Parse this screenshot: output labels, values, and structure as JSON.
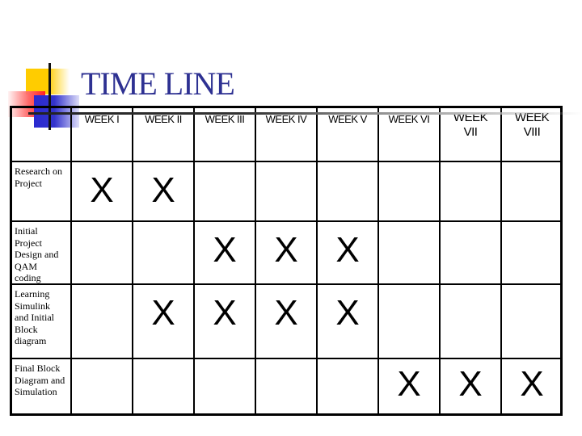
{
  "title": "TIME LINE",
  "weeks": [
    "WEEK I",
    "WEEK II",
    "WEEK III",
    "WEEK IV",
    "WEEK V",
    "WEEK VI",
    "WEEK\nVII",
    "WEEK\nVIII"
  ],
  "week_labels": [
    {
      "line1": "WEEK I",
      "line2": ""
    },
    {
      "line1": "WEEK II",
      "line2": ""
    },
    {
      "line1": "WEEK III",
      "line2": ""
    },
    {
      "line1": "WEEK IV",
      "line2": ""
    },
    {
      "line1": "WEEK V",
      "line2": ""
    },
    {
      "line1": "WEEK VI",
      "line2": ""
    },
    {
      "line1": "WEEK",
      "line2": "VII"
    },
    {
      "line1": "WEEK",
      "line2": "VIII"
    }
  ],
  "tasks": [
    {
      "name": "Research on Project",
      "lines": [
        "Research on",
        "Project"
      ],
      "weeks": [
        1,
        2
      ]
    },
    {
      "name": "Initial Project Design and QAM coding",
      "lines": [
        "Initial",
        "Project",
        "Design and",
        "QAM",
        "coding"
      ],
      "weeks": [
        3,
        4,
        5
      ]
    },
    {
      "name": "Learning Simulink and Initial Block diagram",
      "lines": [
        "Learning",
        "Simulink",
        "and Initial",
        "Block",
        "diagram"
      ],
      "weeks": [
        2,
        3,
        4,
        5
      ]
    },
    {
      "name": "Final Block Diagram and Simulation",
      "lines": [
        "Final Block",
        "Diagram and",
        "Simulation"
      ],
      "weeks": [
        6,
        7,
        8
      ]
    }
  ],
  "mark_symbol": "X",
  "colors": {
    "title": "#2e3192",
    "grid": "#000000",
    "deco_yellow": "#ffcc00",
    "deco_red": "#ff2020",
    "deco_blue": "#3333cc"
  }
}
